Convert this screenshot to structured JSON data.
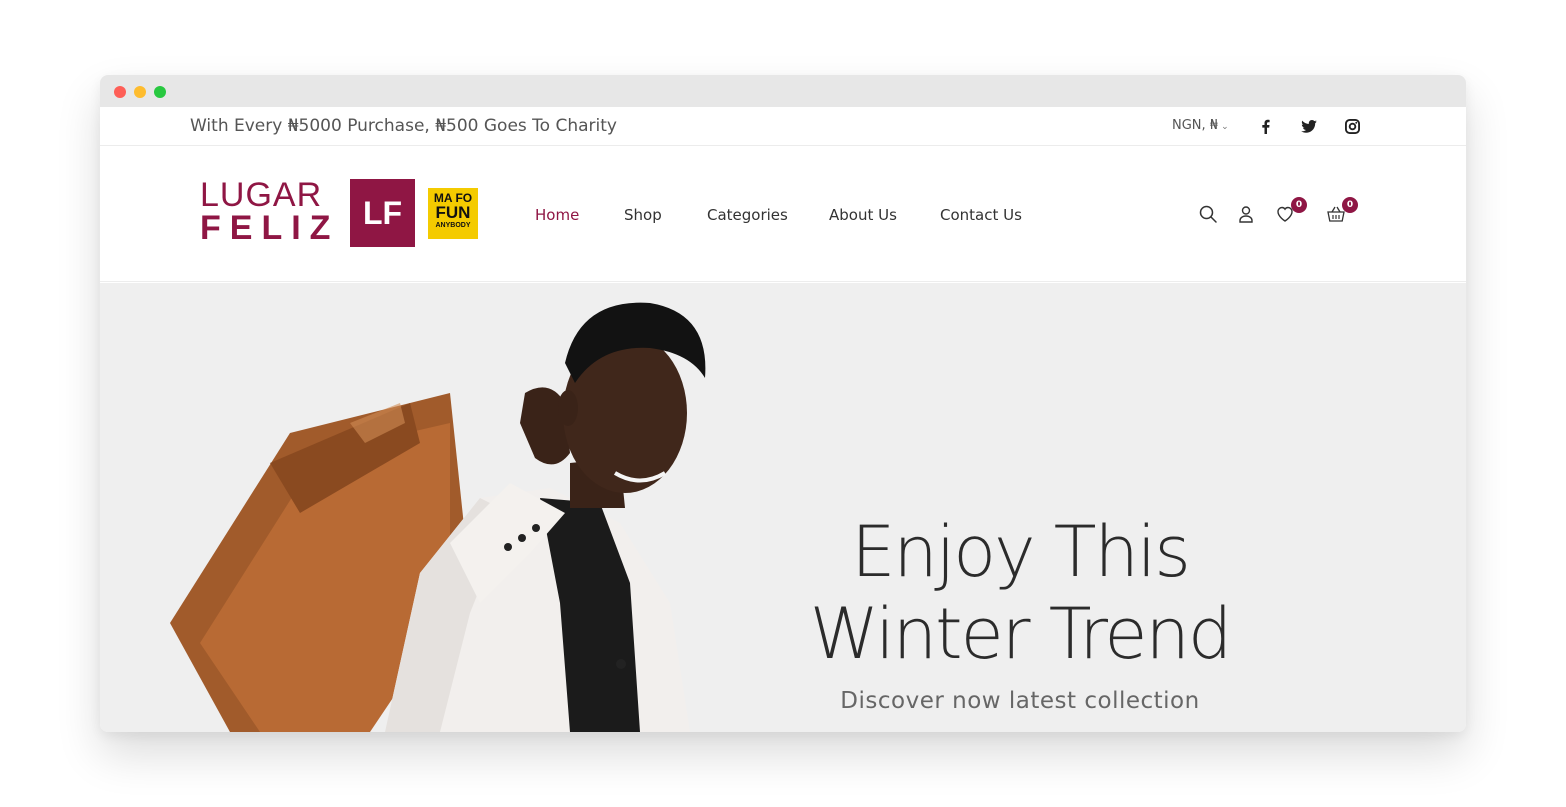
{
  "topbar": {
    "promo_text": "With Every ₦5000 Purchase, ₦500 Goes To Charity",
    "currency_label": "NGN, ₦"
  },
  "brand": {
    "logo_line1": "LUGAR",
    "logo_line2": "FELIZ",
    "logo_badge": "LF",
    "tagline_line1": "MA FO",
    "tagline_line2": "FUN",
    "tagline_line3": "ANYBODY"
  },
  "nav": {
    "items": [
      {
        "label": "Home"
      },
      {
        "label": "Shop"
      },
      {
        "label": "Categories"
      },
      {
        "label": "About Us"
      },
      {
        "label": "Contact Us"
      }
    ]
  },
  "header_icons": {
    "wishlist_count": "0",
    "cart_count": "0"
  },
  "hero": {
    "title_line1": "Enjoy This",
    "title_line2": "Winter Trend",
    "subtitle": "Discover now latest collection"
  },
  "colors": {
    "brand": "#8f1644",
    "accent_yellow": "#f4cb00",
    "hero_bg": "#efefef"
  }
}
